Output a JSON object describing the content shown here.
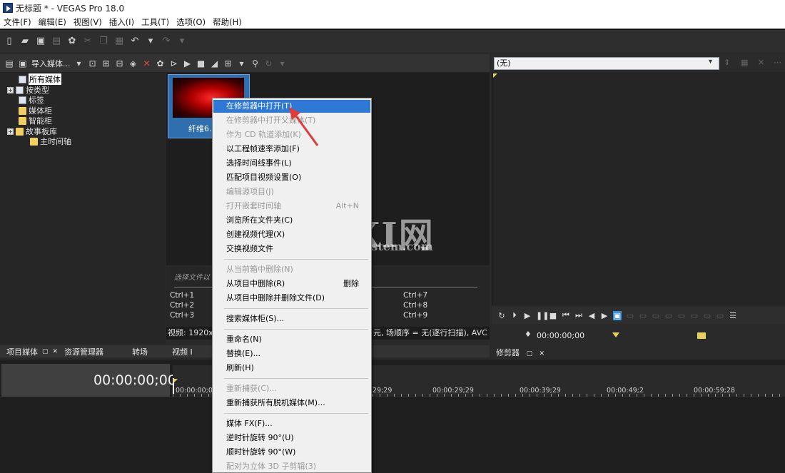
{
  "window": {
    "title": "无标题 * - VEGAS Pro 18.0"
  },
  "menu": [
    "文件(F)",
    "编辑(E)",
    "视图(V)",
    "插入(I)",
    "工具(T)",
    "选项(O)",
    "帮助(H)"
  ],
  "media_toolbar": {
    "import_label": "导入媒体..."
  },
  "tree": {
    "items": [
      "所有媒体",
      "按类型",
      "标签",
      "媒体柜",
      "智能柜",
      "故事板库",
      "主时间轴"
    ]
  },
  "thumbnail": {
    "label": "纤维6."
  },
  "info": {
    "select_hint": "选择文件以",
    "shortcuts_left": [
      "Ctrl+1",
      "Ctrl+2",
      "Ctrl+3"
    ],
    "shortcuts_right": [
      "Ctrl+7",
      "Ctrl+8",
      "Ctrl+9"
    ],
    "video_left": "视频: 1920x",
    "video_right": "元, 场顺序 = 无(逐行扫描), AVC"
  },
  "bottom_tabs": {
    "project_media": "项目媒体",
    "explorer": "资源管理器",
    "transitions": "转场",
    "video": "视频 I"
  },
  "trimmer": {
    "select_value": "(无)",
    "time": "00:00:00;00",
    "tab_label": "修剪器"
  },
  "timeline": {
    "time": "00:00:00;00",
    "ruler_labels": [
      "00:00:00;00",
      "29;29",
      "00:00:29;29",
      "00:00:39;29",
      "00:00:49;2",
      "00:00:59;28"
    ]
  },
  "context_menu": {
    "items": [
      {
        "label": "在修剪器中打开(T)",
        "state": "highlighted"
      },
      {
        "label": "在修剪器中打开父媒体(T)",
        "state": "disabled"
      },
      {
        "label": "作为 CD 轨道添加(K)",
        "state": "disabled"
      },
      {
        "label": "以工程帧速率添加(F)",
        "state": "normal"
      },
      {
        "label": "选择时间线事件(L)",
        "state": "normal"
      },
      {
        "label": "匹配项目视频设置(O)",
        "state": "normal"
      },
      {
        "label": "编辑源项目(J)",
        "state": "disabled"
      },
      {
        "label": "打开嵌套时间轴",
        "shortcut": "Alt+N",
        "state": "disabled"
      },
      {
        "label": "浏览所在文件夹(C)",
        "state": "normal"
      },
      {
        "label": "创建视频代理(X)",
        "state": "normal"
      },
      {
        "label": "交换视频文件",
        "state": "normal"
      },
      {
        "label": "从当前箱中删除(N)",
        "state": "disabled"
      },
      {
        "label": "从项目中删除(R)",
        "shortcut": "删除",
        "state": "normal"
      },
      {
        "label": "从项目中删除并删除文件(D)",
        "state": "normal"
      },
      {
        "label": "搜索媒体柜(S)...",
        "state": "normal"
      },
      {
        "label": "重命名(N)",
        "state": "normal"
      },
      {
        "label": "替换(E)...",
        "state": "normal"
      },
      {
        "label": "刷新(H)",
        "state": "normal"
      },
      {
        "label": "重新捕获(C)...",
        "state": "disabled"
      },
      {
        "label": "重新捕获所有脱机媒体(M)...",
        "state": "normal"
      },
      {
        "label": "媒体 FX(F)...",
        "state": "normal"
      },
      {
        "label": "逆时针旋转 90°(U)",
        "state": "normal"
      },
      {
        "label": "顺时针旋转 90°(W)",
        "state": "normal"
      },
      {
        "label": "配对为立体 3D 子剪辑(3)",
        "state": "disabled"
      }
    ]
  },
  "watermark": {
    "big": "GXI网",
    "small": "system.com"
  },
  "colors": {
    "highlight": "#2f79d6",
    "annotation_arrow": "#e03a3a",
    "dark_bg": "#2a2a2a"
  }
}
